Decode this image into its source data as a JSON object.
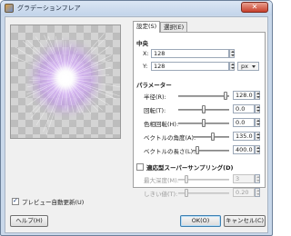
{
  "window": {
    "title": "グラデーションフレア",
    "close_glyph": "✕"
  },
  "preview": {
    "checkbox_label": "プレビュー自動更新(U)",
    "checked": true
  },
  "tabs": [
    {
      "label": "設定(S)",
      "active": true
    },
    {
      "label": "選択(E)",
      "active": false
    }
  ],
  "center": {
    "heading": "中央",
    "x_label": "X:",
    "x_value": "128",
    "y_label": "Y:",
    "y_value": "128",
    "unit": "px"
  },
  "params": {
    "heading": "パラメーター",
    "rows": [
      {
        "label": "半径(R):",
        "value": "128.0"
      },
      {
        "label": "回転(T):",
        "value": "0.0"
      },
      {
        "label": "色相回転(H):",
        "value": "0.0"
      },
      {
        "label": "ベクトルの角度(A):",
        "value": "135.0"
      },
      {
        "label": "ベクトルの長さ(L):",
        "value": "400.0"
      }
    ]
  },
  "supersample": {
    "label": "適応型スーパーサンプリング(D)",
    "checked": false,
    "rows": [
      {
        "label": "最大深度(M):",
        "value": "3"
      },
      {
        "label": "しきい値(T):",
        "value": "0.20"
      }
    ]
  },
  "buttons": {
    "help": "ヘルプ(H)",
    "ok": "OK(O)",
    "cancel": "キャンセル(C)"
  },
  "colors": {
    "accent": "#3c7fb1",
    "flare_core": "#ffffff",
    "flare_glow": "#c8a0f0"
  }
}
